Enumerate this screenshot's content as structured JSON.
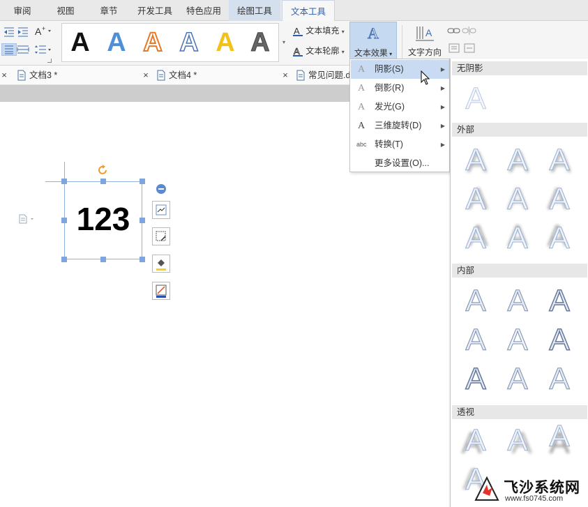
{
  "tabs": [
    {
      "label": "审阅"
    },
    {
      "label": "视图"
    },
    {
      "label": "章节"
    },
    {
      "label": "开发工具"
    },
    {
      "label": "特色应用"
    },
    {
      "label": "绘图工具"
    },
    {
      "label": "文本工具"
    }
  ],
  "ribbon": {
    "style_gallery": [
      "A",
      "A",
      "A",
      "A",
      "A",
      "A"
    ],
    "text_fill": "文本填充",
    "text_outline": "文本轮廓",
    "text_effects": "文本效果",
    "text_direction": "文字方向",
    "big_a": "A"
  },
  "doc_tabs": [
    {
      "label": "文档3 *"
    },
    {
      "label": "文档4 *"
    },
    {
      "label": "常见问题.d"
    }
  ],
  "canvas": {
    "textbox_text": "123"
  },
  "effects_menu": {
    "items": [
      {
        "icon": "A",
        "label": "阴影(S)"
      },
      {
        "icon": "A",
        "label": "倒影(R)"
      },
      {
        "icon": "A",
        "label": "发光(G)"
      },
      {
        "icon": "A",
        "label": "三维旋转(D)"
      },
      {
        "icon": "abc",
        "label": "转换(T)"
      },
      {
        "label": "更多设置(O)..."
      }
    ]
  },
  "shadow_submenu": {
    "no_shadow": "无阴影",
    "outer": "外部",
    "inner": "内部",
    "perspective": "透视",
    "glyph": "A"
  },
  "watermark": {
    "brand": "飞沙系统网",
    "url": "www.fs0745.com"
  },
  "colors": {
    "accent": "#2b63b5",
    "highlight": "#c8dbf2",
    "effects_button": "#c5d9f1"
  }
}
